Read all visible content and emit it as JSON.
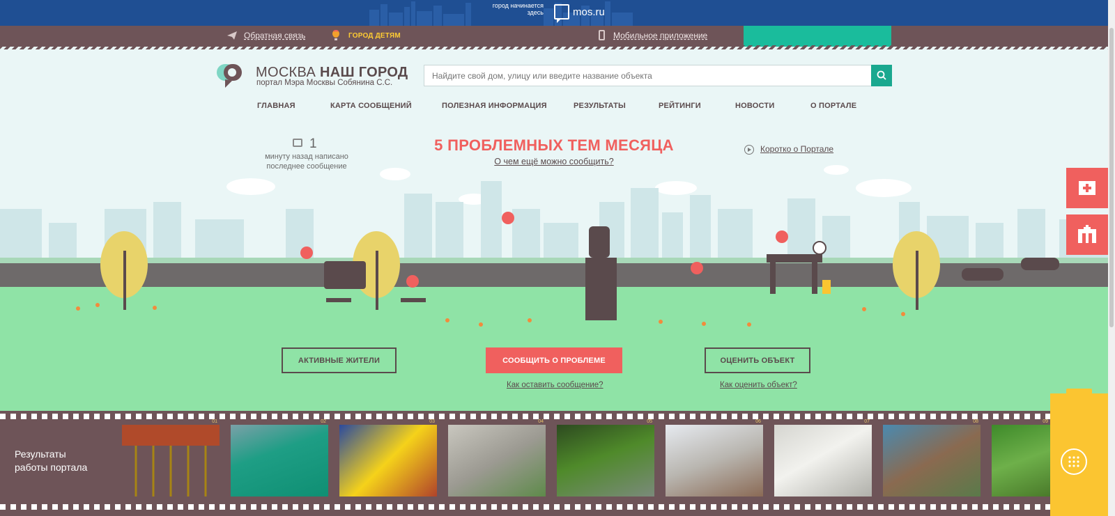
{
  "mosbar": {
    "slogan": "город начинается здесь",
    "site": "mos.ru"
  },
  "topbar": {
    "feedback": "Обратная связь",
    "kids": "ГОРОД ДЕТЯМ",
    "app": "Мобильное приложение"
  },
  "header": {
    "brand_light": "МОСКВА ",
    "brand_bold": "НАШ ГОРОД",
    "subtitle": "портал Мэра Москвы Собянина С.С.",
    "search_placeholder": "Найдите свой дом, улицу или введите название объекта"
  },
  "nav": [
    "ГЛАВНАЯ",
    "КАРТА СООБЩЕНИЙ",
    "ПОЛЕЗНАЯ ИНФОРМАЦИЯ",
    "РЕЗУЛЬТАТЫ",
    "РЕЙТИНГИ",
    "НОВОСТИ",
    "О ПОРТАЛЕ"
  ],
  "hero": {
    "counter": "1",
    "counter_text": "минуту назад написано последнее сообщение",
    "title": "5 ПРОБЛЕМНЫХ ТЕМ МЕСЯЦА",
    "link": "О чем ещё можно сообщить?",
    "about": "Коротко о Портале"
  },
  "actions": {
    "active": "АКТИВНЫЕ ЖИТЕЛИ",
    "report": "СООБЩИТЬ О ПРОБЛЕМЕ",
    "rate": "ОЦЕНИТЬ ОБЪЕКТ",
    "how_report": "Как оставить сообщение?",
    "how_rate": "Как оценить объект?"
  },
  "film": {
    "label": "Результаты работы портала",
    "photos": [
      "01",
      "02",
      "03",
      "04",
      "05",
      "06",
      "07",
      "08",
      "09"
    ]
  },
  "colors": {
    "accent": "#f0605e",
    "teal": "#1abc9c",
    "brown": "#6e5458",
    "yellow": "#fbc531",
    "blue": "#1f4f93"
  }
}
